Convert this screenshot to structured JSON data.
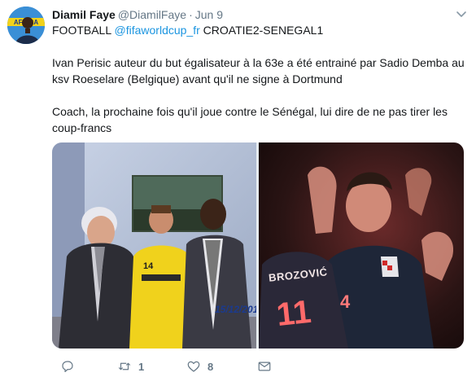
{
  "tweet": {
    "author_name": "Diamil Faye",
    "handle": "@DiamilFaye",
    "separator": "·",
    "date": "Jun 9",
    "avatar_text": "AFRICA",
    "text_line1_prefix": "FOOTBALL ",
    "mention": "@fifaworldcup_fr",
    "text_line1_suffix": " CROATIE2-SENEGAL1",
    "paragraph2": "Ivan Perisic auteur du but égalisateur à la 63e a été entrainé par Sadio Demba au ksv Roeselare (Belgique) avant qu'il ne signe à Dortmund",
    "paragraph3": "Coach, la prochaine fois qu'il joue contre le Sénégal, lui dire de ne pas tirer les coup-francs"
  },
  "media": {
    "left_photo": {
      "timestamp_stamp": "15/12/201",
      "shirt_number": "14"
    },
    "right_photo": {
      "jersey_name": "BROZOVIĆ",
      "jersey_number_left": "11",
      "jersey_number_right": "4"
    }
  },
  "actions": {
    "reply_count": "",
    "retweet_count": "1",
    "like_count": "8"
  },
  "colors": {
    "link": "#1b95e0",
    "secondary_text": "#657786",
    "primary_text": "#14171a"
  },
  "icons": [
    "caret-down-icon",
    "reply-icon",
    "retweet-icon",
    "like-icon",
    "direct-message-icon"
  ]
}
